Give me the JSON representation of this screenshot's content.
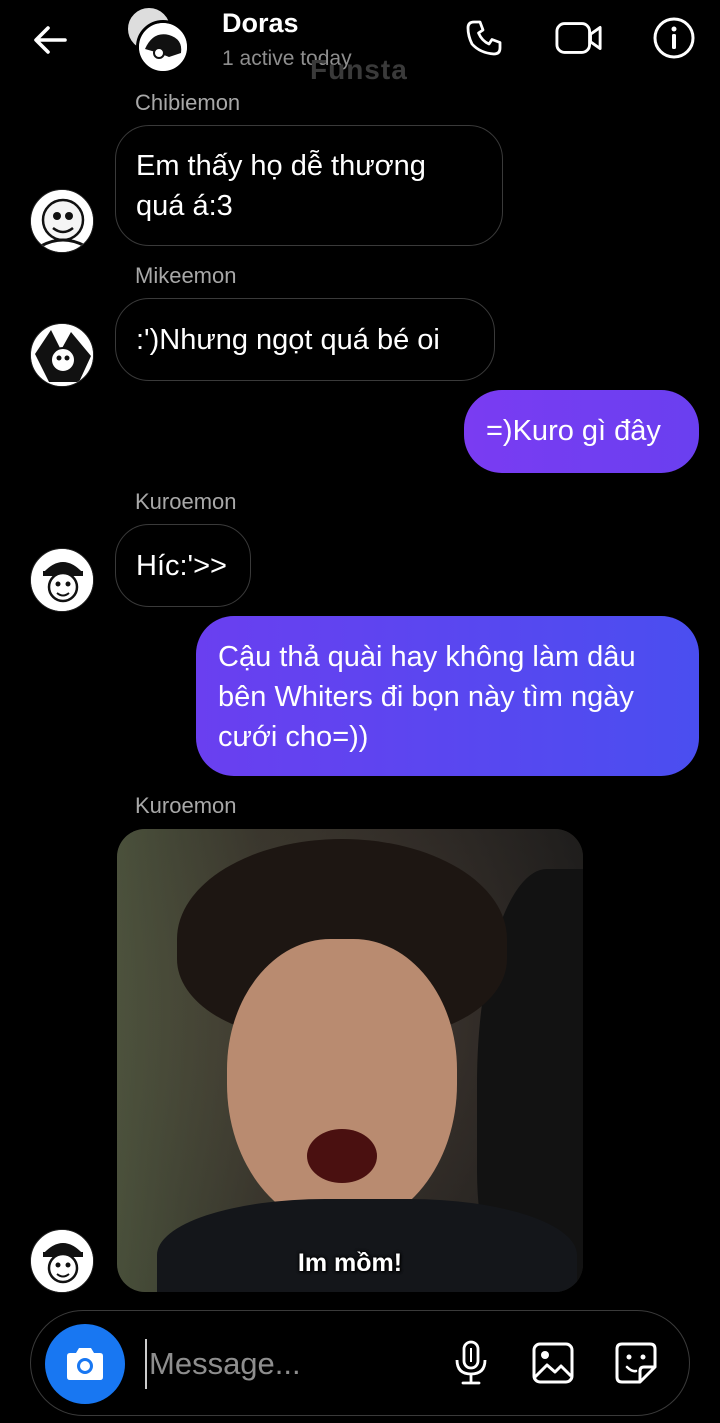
{
  "header": {
    "title": "Doras",
    "status": "1 active today",
    "watermark": "Funsta"
  },
  "messages": [
    {
      "sender": "Chibiemon",
      "text": "Em thấy họ dễ thương quá á:3",
      "direction": "incoming"
    },
    {
      "sender": "Mikeemon",
      "text": ":')Nhưng ngọt quá bé oi",
      "direction": "incoming"
    },
    {
      "text": "=)Kuro gì đây",
      "direction": "outgoing"
    },
    {
      "sender": "Kuroemon",
      "text": "Híc:'>>",
      "direction": "incoming"
    },
    {
      "text": "Cậu thả quài hay không làm dâu bên Whiters đi bọn này tìm ngày cưới cho=))",
      "direction": "outgoing"
    },
    {
      "sender": "Kuroemon",
      "type": "image",
      "caption": "Im mồm!",
      "direction": "incoming"
    }
  ],
  "composer": {
    "placeholder": "Message..."
  },
  "colors": {
    "background": "#000000",
    "outgoing_start": "#7a3cf2",
    "outgoing_end": "#4a4ef0",
    "camera_button": "#1877f2",
    "secondary_text": "#8e8e8e"
  },
  "icons": [
    "back-arrow-icon",
    "phone-icon",
    "video-camera-icon",
    "info-icon",
    "camera-icon",
    "microphone-icon",
    "gallery-icon",
    "sticker-icon"
  ]
}
